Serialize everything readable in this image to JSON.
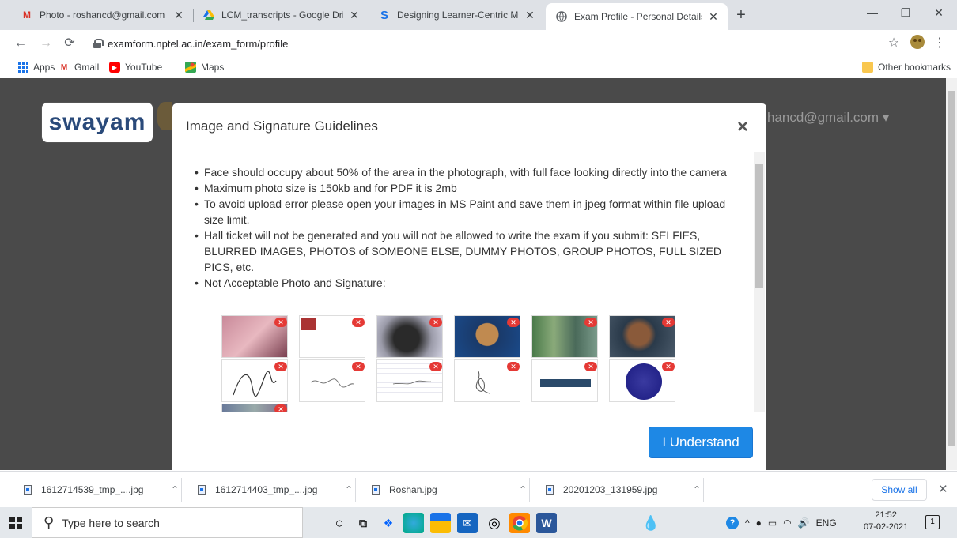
{
  "browser": {
    "tabs": [
      {
        "title": "Photo - roshancd@gmail.com - G",
        "favicon": "gmail-icon"
      },
      {
        "title": "LCM_transcripts - Google Drive",
        "favicon": "drive-icon"
      },
      {
        "title": "Designing Learner-Centric MOOC",
        "favicon": "s-icon"
      },
      {
        "title": "Exam Profile - Personal Details",
        "favicon": "globe-icon"
      }
    ],
    "url": "examform.nptel.ac.in/exam_form/profile",
    "bookmarks": [
      "Apps",
      "Gmail",
      "YouTube",
      "Maps"
    ],
    "other_bookmarks": "Other bookmarks"
  },
  "background": {
    "logo_text": "swayam",
    "user_email": "hancd@gmail.com"
  },
  "modal": {
    "title": "Image and Signature Guidelines",
    "close_glyph": "×",
    "guidelines": [
      "Face should occupy about 50% of the area in the photograph, with full face looking directly into the camera",
      "Maximum photo size is 150kb and for PDF it is 2mb",
      "To avoid upload error please open your images in MS Paint and save them in jpeg format within file upload size limit.",
      "Hall ticket will not be generated and you will not be allowed to write the exam if you submit: SELFIES, BLURRED IMAGES, PHOTOS of SOMEONE ELSE, DUMMY PHOTOS, GROUP PHOTOS, FULL SIZED PICS, etc.",
      "Not Acceptable Photo and Signature:"
    ],
    "button_label": "I Understand"
  },
  "downloads": {
    "items": [
      "1612714539_tmp_....jpg",
      "1612714403_tmp_....jpg",
      "Roshan.jpg",
      "20201203_131959.jpg"
    ],
    "show_all": "Show all"
  },
  "taskbar": {
    "search_placeholder": "Type here to search",
    "language": "ENG",
    "time": "21:52",
    "date": "07-02-2021"
  },
  "colors": {
    "accent": "#1e88e5",
    "overlay": "#4a4a4a",
    "reject_badge": "#e53935"
  }
}
